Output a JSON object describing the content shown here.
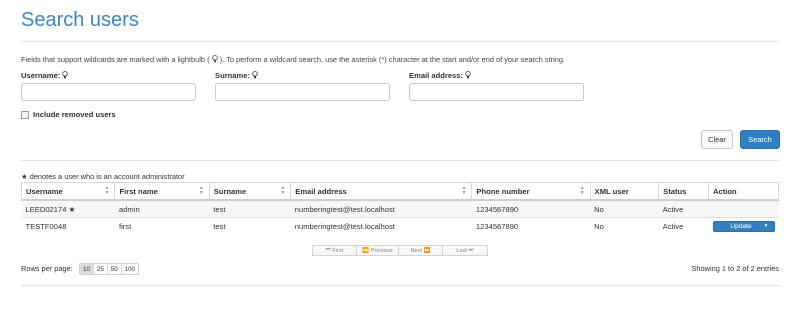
{
  "page": {
    "title": "Search users"
  },
  "help": {
    "before": "Fields that support wildcards are marked with a lightbulb (",
    "after": "). To perform a wildcard search, use the asterisk (*) character at the start and/or end of your search string."
  },
  "fields": {
    "username": {
      "label": "Username:",
      "value": ""
    },
    "surname": {
      "label": "Surname:",
      "value": ""
    },
    "email": {
      "label": "Email address:",
      "value": ""
    }
  },
  "include_removed": {
    "label": "Include removed users",
    "checked": false
  },
  "buttons": {
    "clear": "Clear",
    "search": "Search"
  },
  "admin_note": "denotes a user who is an account administrator",
  "table": {
    "columns": [
      "Username",
      "First name",
      "Surname",
      "Email address",
      "Phone number",
      "XML user",
      "Status",
      "Action"
    ],
    "rows": [
      {
        "username": "LEED02174",
        "admin": true,
        "first_name": "admin",
        "surname": "test",
        "email": "numberingtest@test.localhost",
        "phone": "1234567890",
        "xml_user": "No",
        "status": "Active",
        "action": ""
      },
      {
        "username": "TESTF0048",
        "admin": false,
        "first_name": "first",
        "surname": "test",
        "email": "numberingtest@test.localhost",
        "phone": "1234567890",
        "xml_user": "No",
        "status": "Active",
        "action": "Update"
      }
    ]
  },
  "pagination": {
    "first": "First",
    "previous": "Previous",
    "next": "Next",
    "last": "Last"
  },
  "rows_per_page": {
    "label": "Rows per page:",
    "options": [
      "10",
      "25",
      "50",
      "100"
    ],
    "selected": "10"
  },
  "showing": "Showing 1 to 2 of 2 entries",
  "colors": {
    "accent": "#2f7fc1",
    "title": "#3a87c9"
  },
  "icons": {
    "bulb": "lightbulb-icon",
    "admin": "star-icon"
  }
}
